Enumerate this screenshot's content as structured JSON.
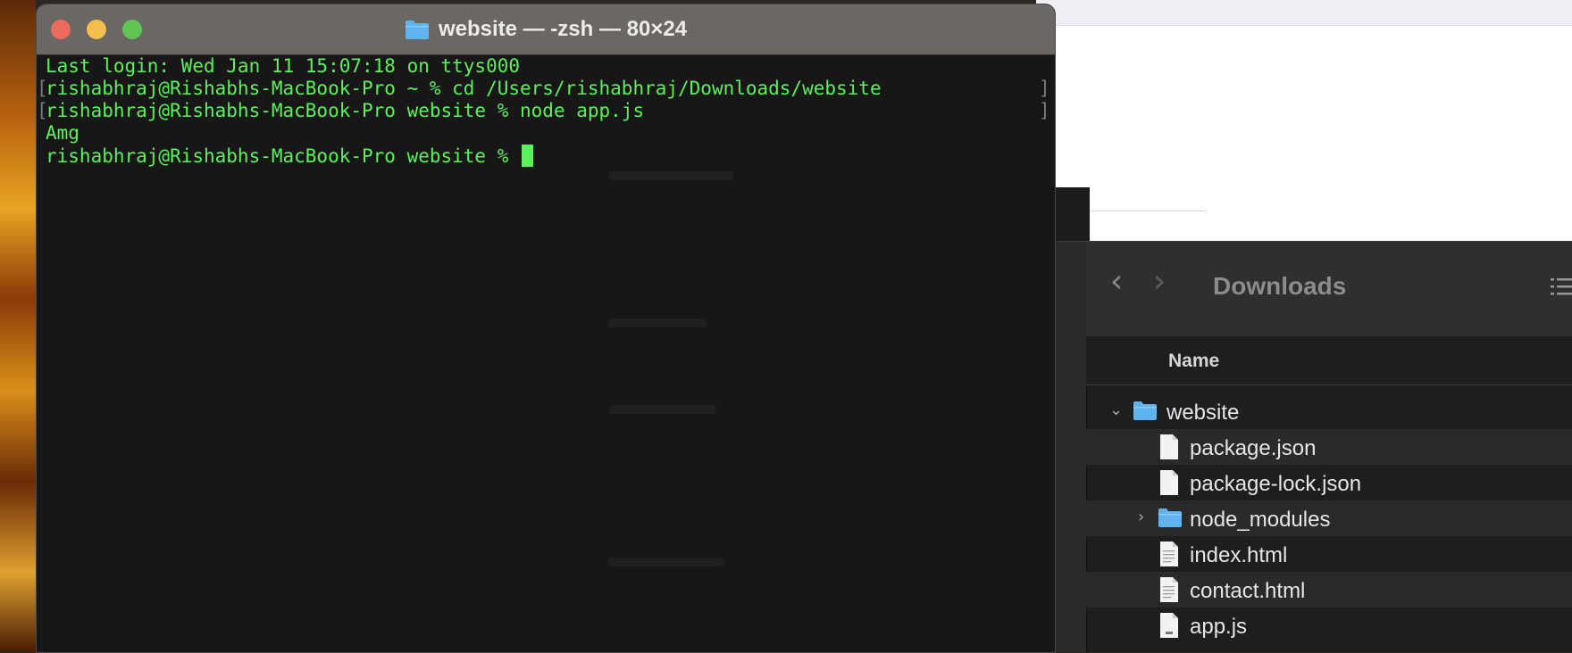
{
  "terminal": {
    "title": "website — -zsh — 80×24",
    "lines": [
      "Last login: Wed Jan 11 15:07:18 on ttys000",
      "rishabhraj@Rishabhs-MacBook-Pro ~ % cd /Users/rishabhraj/Downloads/website",
      "rishabhraj@Rishabhs-MacBook-Pro website % node app.js",
      "Amg",
      "rishabhraj@Rishabhs-MacBook-Pro website % "
    ],
    "colors": {
      "text": "#5cf15c",
      "background": "#171717",
      "titlebar": "#6b6763"
    }
  },
  "finder": {
    "folder_title": "Downloads",
    "column_header": "Name",
    "items": [
      {
        "name": "website",
        "kind": "folder",
        "expanded": true,
        "depth": 0
      },
      {
        "name": "package.json",
        "kind": "file",
        "depth": 1
      },
      {
        "name": "package-lock.json",
        "kind": "file",
        "depth": 1
      },
      {
        "name": "node_modules",
        "kind": "folder",
        "expanded": false,
        "depth": 1
      },
      {
        "name": "index.html",
        "kind": "file",
        "depth": 1
      },
      {
        "name": "contact.html",
        "kind": "file",
        "depth": 1
      },
      {
        "name": "app.js",
        "kind": "file",
        "depth": 1
      }
    ],
    "icons": {
      "back": "chevron-left-icon",
      "forward": "chevron-right-icon",
      "view": "list-view-icon"
    },
    "colors": {
      "folder": "#5fb4f0",
      "background": "#1e1e1e"
    }
  }
}
